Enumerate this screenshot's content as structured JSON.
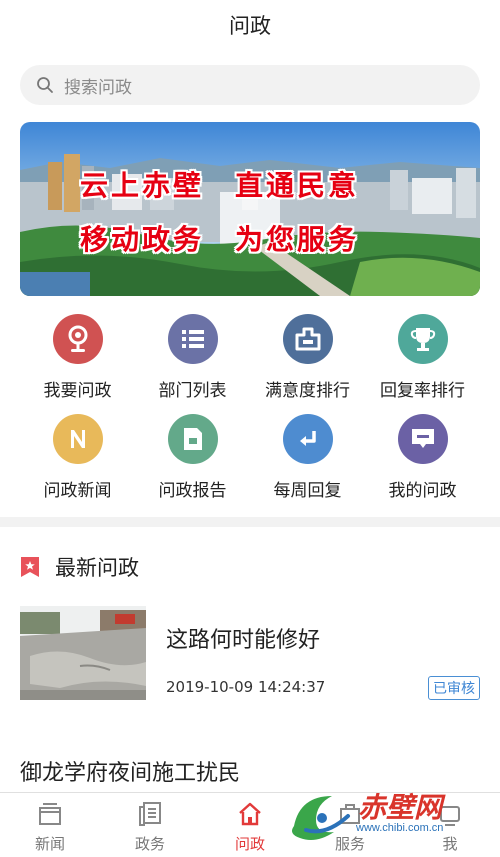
{
  "header": {
    "title": "问政"
  },
  "search": {
    "placeholder": "搜索问政"
  },
  "banner": {
    "line1": "云上赤壁　直通民意",
    "line2": "移动政务　为您服务"
  },
  "grid": {
    "items": [
      {
        "label": "我要问政",
        "icon": "microphone-icon",
        "color": "#d05252"
      },
      {
        "label": "部门列表",
        "icon": "list-icon",
        "color": "#6b72a6"
      },
      {
        "label": "满意度排行",
        "icon": "ranking-icon",
        "color": "#4f6f9a"
      },
      {
        "label": "回复率排行",
        "icon": "trophy-icon",
        "color": "#4fa89a"
      },
      {
        "label": "问政新闻",
        "icon": "news-n-icon",
        "color": "#e8b95a"
      },
      {
        "label": "问政报告",
        "icon": "report-icon",
        "color": "#63a98a"
      },
      {
        "label": "每周回复",
        "icon": "reply-icon",
        "color": "#4e8cd0"
      },
      {
        "label": "我的问政",
        "icon": "message-icon",
        "color": "#6b61a5"
      }
    ]
  },
  "section": {
    "title": "最新问政"
  },
  "news": [
    {
      "title": "这路何时能修好",
      "time": "2019-10-09 14:24:37",
      "status": "已审核"
    },
    {
      "title": "御龙学府夜间施工扰民"
    }
  ],
  "tabbar": {
    "tabs": [
      {
        "label": "新闻",
        "icon": "news-icon"
      },
      {
        "label": "政务",
        "icon": "government-icon"
      },
      {
        "label": "问政",
        "icon": "home-icon",
        "active": true
      },
      {
        "label": "服务",
        "icon": "service-icon"
      },
      {
        "label": "我",
        "icon": "user-icon"
      }
    ],
    "active_color": "#e23a3a"
  },
  "watermark": {
    "text": "赤壁网",
    "url": "www.chibi.com.cn"
  }
}
